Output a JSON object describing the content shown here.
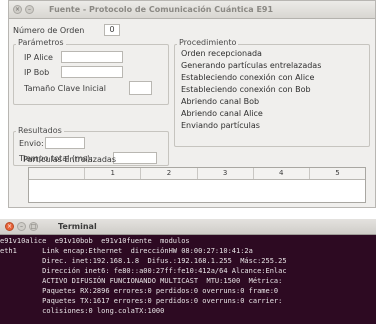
{
  "main_window": {
    "title": "Fuente - Protocolo de Comunicación Cuántica E91",
    "order_label": "Número de Orden",
    "order_value": "0",
    "parametros": {
      "title": "Parámetros",
      "ip_alice_label": "IP Alice",
      "ip_bob_label": "IP Bob",
      "key_size_label": "Tamaño Clave Inicial"
    },
    "resultados": {
      "title": "Resultados",
      "envio_label": "Envio:",
      "tiempo_label": "Tiempo total (ms):"
    },
    "procedimiento": {
      "title": "Procedimiento",
      "items": [
        "Orden recepcionada",
        "Generando partículas entrelazadas",
        "Estableciendo conexión con Alice",
        "Estableciendo conexión con Bob",
        "Abriendo canal Bob",
        "Abriendo canal Alice",
        "Enviando partículas"
      ]
    },
    "particulas": {
      "title": "Partículas Entrelazadas",
      "columns": [
        "",
        "1",
        "2",
        "3",
        "4",
        "5"
      ]
    }
  },
  "terminal": {
    "title": "Terminal",
    "lines": [
      "e91v10alice  e91v10bob  e91v10fuente  modulos",
      "eth1      Link encap:Ethernet  direcciónHW 08:00:27:10:41:2a",
      "          Direc. inet:192.168.1.8  Difus.:192.168.1.255  Másc:255.25",
      "          Dirección inet6: fe80::a00:27ff:fe10:412a/64 Alcance:Enlac",
      "          ACTIVO DIFUSIÓN FUNCIONANDO MULTICAST  MTU:1500  Métrica:",
      "          Paquetes RX:2896 errores:0 perdidos:0 overruns:0 frame:0",
      "          Paquetes TX:1617 errores:0 perdidos:0 overruns:0 carrier:",
      "          colisiones:0 long.colaTX:1000"
    ]
  }
}
